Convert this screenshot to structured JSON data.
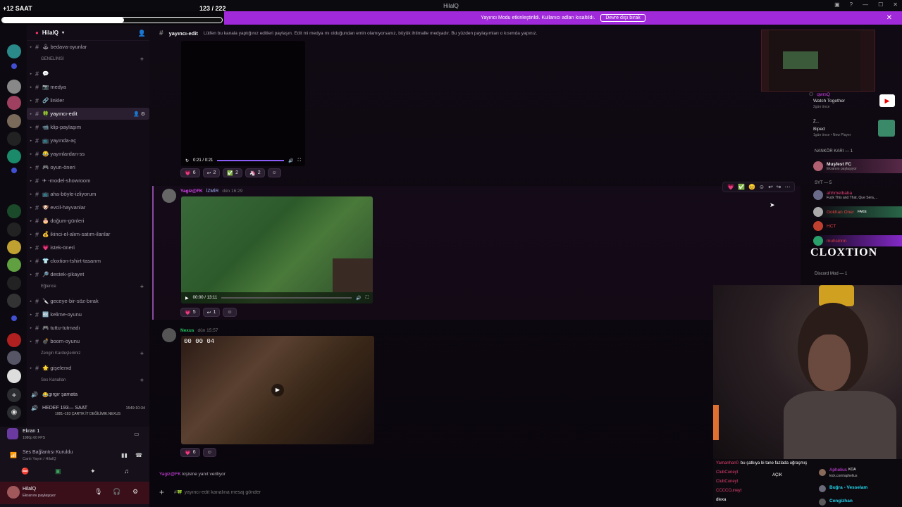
{
  "overlay": {
    "left_label": "+12 SAAT",
    "count_label": "123 / 222",
    "progress": 0.554
  },
  "window": {
    "title": "HilalQ"
  },
  "banner": {
    "text": "Yayıncı Modu etkinleştirildi. Kullanıcı adları kısaltıldı.",
    "button": "Devre dışı bırak"
  },
  "server": {
    "name": "HilalQ"
  },
  "channels": [
    {
      "name": "bedava-oyunlar",
      "emoji": "🕹"
    },
    {
      "category": "GENELİMSİ"
    },
    {
      "name": "",
      "emoji": "💬"
    },
    {
      "name": "medya",
      "emoji": "📷"
    },
    {
      "name": "linkler",
      "emoji": "🔗"
    },
    {
      "name": "yayıncı-edit",
      "emoji": "🍀",
      "selected": true
    },
    {
      "name": "klip-paylaşım",
      "emoji": "📹"
    },
    {
      "name": "yayında-aç",
      "emoji": "📺"
    },
    {
      "name": "yayınlardan-ss",
      "emoji": "😂"
    },
    {
      "name": "oyun-öneri",
      "emoji": "🎮"
    },
    {
      "name": "-model-showroom",
      "emoji": "✈"
    },
    {
      "name": "aha-böyle-izliyorum",
      "emoji": "📺"
    },
    {
      "name": "evcil-hayvanlar",
      "emoji": "🐶"
    },
    {
      "name": "doğum-günleri",
      "emoji": "🎂"
    },
    {
      "name": "ikinci-el-alım-satım-ilanlar",
      "emoji": "💰"
    },
    {
      "name": "istek-öneri",
      "emoji": "💗"
    },
    {
      "name": "cloxtion-tshirt-tasarım",
      "emoji": "👕"
    },
    {
      "name": "destek-şikayet",
      "emoji": "🔎"
    },
    {
      "category": "Eğlence"
    },
    {
      "name": "geceye-bir-söz-bırak",
      "emoji": "🔪"
    },
    {
      "name": "kelime-oyunu",
      "emoji": "🔤"
    },
    {
      "name": "tuttu-tutmadı",
      "emoji": "🎮"
    },
    {
      "name": "boom-oyunu",
      "emoji": "💣"
    },
    {
      "category": "Zengin Kardeşlerimiz"
    },
    {
      "name": "gişelerxd",
      "emoji": "🌟"
    },
    {
      "category": "Ses Kanalları"
    }
  ],
  "voice": [
    {
      "name": "gırgır şamata",
      "emoji": "😂"
    },
    {
      "name": "HEDEF 193— SAAT",
      "sub": "1081–193 ÇARTIK İT DEĞİLİMIK.NEXUS",
      "time": "1549:10:34"
    }
  ],
  "screen_share": {
    "title": "Ekran 1",
    "sub": "1080p 60 FPS"
  },
  "voice_status": {
    "title": "Ses Bağlantısı Kuruldu",
    "sub": "Canlı Yayın / HilalQ"
  },
  "user": {
    "name": "HilalQ",
    "status": "Ekranını paylaşıyor"
  },
  "channel_header": {
    "name": "yayıncı-edit",
    "topic": "Lütfen bu kanala yaptığınız editleri paylaşın. Edit mi medya mı olduğundan emin olamıyorsanız, büyük ihtimalle medyadır. Bu yüzden paylaşımları o kısımda yapınız."
  },
  "messages": [
    {
      "video_time": "0:21 / 0:21",
      "video_progress": 1.0,
      "reactions": [
        {
          "e": "💗",
          "c": "6"
        },
        {
          "e": "↩",
          "c": "2"
        },
        {
          "e": "✅",
          "c": "2"
        },
        {
          "e": "🦄",
          "c": "2"
        }
      ]
    },
    {
      "author": "Yagiz@FK",
      "badge": "İZMİR",
      "time": "dün 16:29",
      "video_time": "00:00 / 13:11",
      "video_progress": 0.0,
      "reactions": [
        {
          "e": "💗",
          "c": "5"
        },
        {
          "e": "↩",
          "c": "1"
        }
      ]
    },
    {
      "author": "Nexus",
      "time": "dün 15:57",
      "timer": "00  00  04",
      "reactions": [
        {
          "e": "💗",
          "c": "6"
        }
      ]
    }
  ],
  "reply": {
    "text": "kişisine yanıt veriliyor",
    "user": "Yagiz@FK"
  },
  "composer": {
    "placeholder": "#🍀 yayıncı-edit kanalına mesaj gönder"
  },
  "members": [
    {
      "name": "qwrsQ",
      "activity": "Watch Together",
      "sub": "2gün önce"
    },
    {
      "name": "Z...",
      "activity": "Biped",
      "sub": "1gün önce • New Player"
    },
    {
      "role": "NANKÖR KARI — 1"
    },
    {
      "name": "Muşfest FC",
      "sub": "Ekranını paylaşıyor"
    },
    {
      "role": "SYT — 5"
    },
    {
      "name": "ahhmetbaba",
      "sub": "Fuck This and That, Que Sera,..."
    },
    {
      "name": "Gokhan Oner",
      "tag": "FAKE"
    },
    {
      "name": "HCT"
    },
    {
      "name": "muhsinnn"
    },
    {
      "name": "CLOXTION"
    },
    {
      "role": "Discord Mod — 1"
    }
  ],
  "chat": [
    {
      "user": "Yamanhan0",
      "text": "bu şatkıya bi tane fazlada uğraşmış"
    },
    {
      "user": "ClubCuneyt",
      "text": ""
    },
    {
      "user": "ClubCuneyt",
      "text": ""
    },
    {
      "user": "CCCCCuneyt",
      "text": ""
    },
    {
      "user": "dlexa",
      "text": ""
    }
  ],
  "chat_members": [
    {
      "name": "Aphelius",
      "tag": "KOA",
      "sub": "kick.com/aphelius"
    },
    {
      "name": "Buğra - Vesselam"
    },
    {
      "name": "Cengizhan"
    }
  ],
  "cam_label": "AÇIK"
}
